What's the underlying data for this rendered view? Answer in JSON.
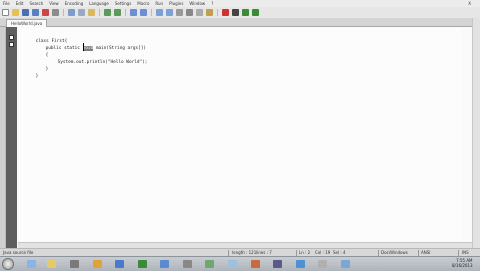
{
  "menubar": {
    "items": [
      "File",
      "Edit",
      "Search",
      "View",
      "Encoding",
      "Language",
      "Settings",
      "Macro",
      "Run",
      "Plugins",
      "Window",
      "?"
    ],
    "close_label": "X"
  },
  "tabs": [
    {
      "label": "HelloWorld.java"
    }
  ],
  "editor": {
    "lines": [
      {
        "text": "class First{",
        "indent": 0
      },
      {
        "pre": "public static ",
        "sel": "void",
        "post": " main(String args[])",
        "indent": 1
      },
      {
        "text": "{",
        "indent": 1
      },
      {
        "text": "System.out.println(\"Hello World\");",
        "indent": 2
      },
      {
        "text": "}",
        "indent": 1
      },
      {
        "text": "}",
        "indent": 0
      }
    ]
  },
  "statusbar": {
    "file_type": "Java source file",
    "length": "length : 121",
    "lines": "lines : 7",
    "position": "Ln : 2",
    "column": "Col : 19",
    "selection": "Sel : 4",
    "eol": "Dos\\Windows",
    "encoding": "ANSI",
    "mode": "INS"
  },
  "taskbar": {
    "time": "7:55 AM",
    "date": "8/16/2013"
  },
  "colors": {
    "gutter": "#5e5e5e",
    "selection": "#7d7d7d",
    "taskbar": "#b8bdc3"
  }
}
